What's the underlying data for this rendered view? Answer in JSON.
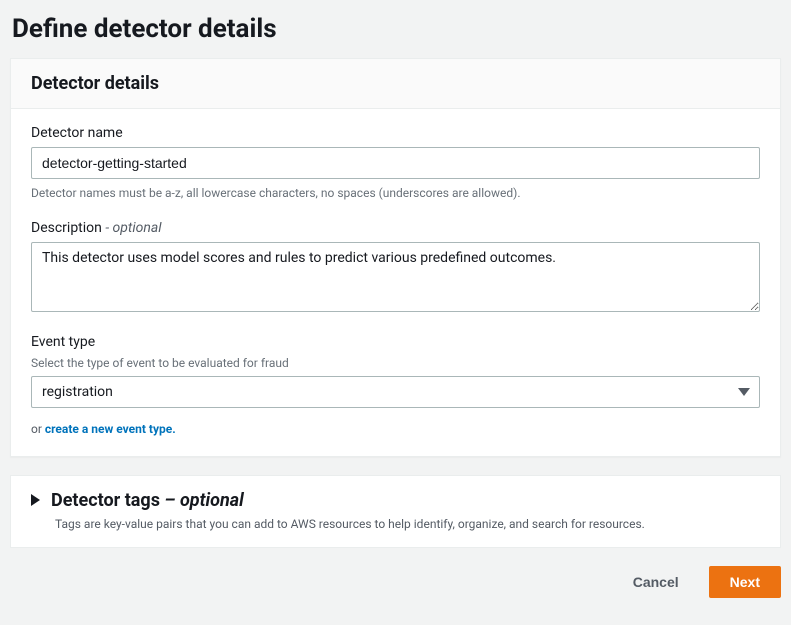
{
  "page": {
    "title": "Define detector details"
  },
  "card": {
    "header": "Detector details",
    "name": {
      "label": "Detector name",
      "value": "detector-getting-started",
      "helper": "Detector names must be a-z, all lowercase characters, no spaces (underscores are allowed)."
    },
    "description": {
      "label": "Description",
      "optional": "- optional",
      "value": "This detector uses model scores and rules to predict various predefined outcomes."
    },
    "eventType": {
      "label": "Event type",
      "helper": "Select the type of event to be evaluated for fraud",
      "selected": "registration",
      "orText": "or ",
      "createLink": "create a new event type."
    }
  },
  "tagsCard": {
    "title": "Detector tags ",
    "optional": "– optional",
    "description": "Tags are key-value pairs that you can add to AWS resources to help identify, organize, and search for resources."
  },
  "buttons": {
    "cancel": "Cancel",
    "next": "Next"
  }
}
